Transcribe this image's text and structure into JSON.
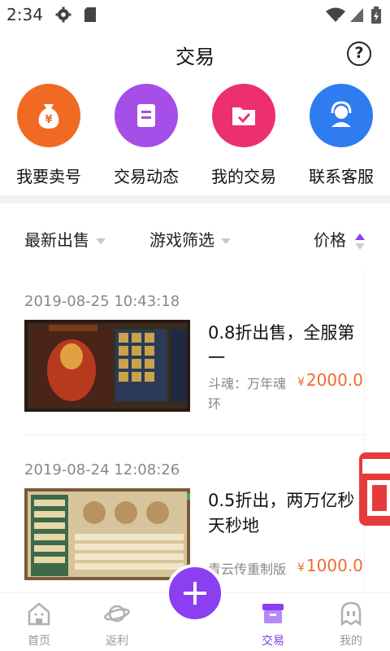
{
  "status_bar": {
    "time": "2:34"
  },
  "header": {
    "title": "交易",
    "help_symbol": "?"
  },
  "quick_actions": [
    {
      "label": "我要卖号",
      "color": "#f06a23",
      "icon": "money-bag-icon"
    },
    {
      "label": "交易动态",
      "color": "#a54ee8",
      "icon": "document-icon"
    },
    {
      "label": "我的交易",
      "color": "#ec2f6e",
      "icon": "folder-check-icon"
    },
    {
      "label": "联系客服",
      "color": "#2f7cf0",
      "icon": "headset-icon"
    }
  ],
  "filters": [
    {
      "label": "最新出售"
    },
    {
      "label": "游戏筛选"
    },
    {
      "label": "价格"
    }
  ],
  "listings": [
    {
      "date": "2019-08-25 10:43:18",
      "title_line1": "0.8折出售，全服第",
      "title_line2": "一",
      "game": "斗魂：万年魂",
      "game_wrap": "环",
      "price_symbol": "¥",
      "price": "2000.0"
    },
    {
      "date": "2019-08-24 12:08:26",
      "title_line1": "0.5折出，两万亿秒",
      "title_line2": "天秒地",
      "game": "青云传重制版",
      "price_symbol": "¥",
      "price": "1000.0"
    }
  ],
  "tabs": [
    {
      "label": "首页"
    },
    {
      "label": "返利"
    },
    {
      "label": "交易"
    },
    {
      "label": "我的"
    }
  ],
  "colors": {
    "accent": "#8b3ff0",
    "price": "#f26a2e"
  }
}
